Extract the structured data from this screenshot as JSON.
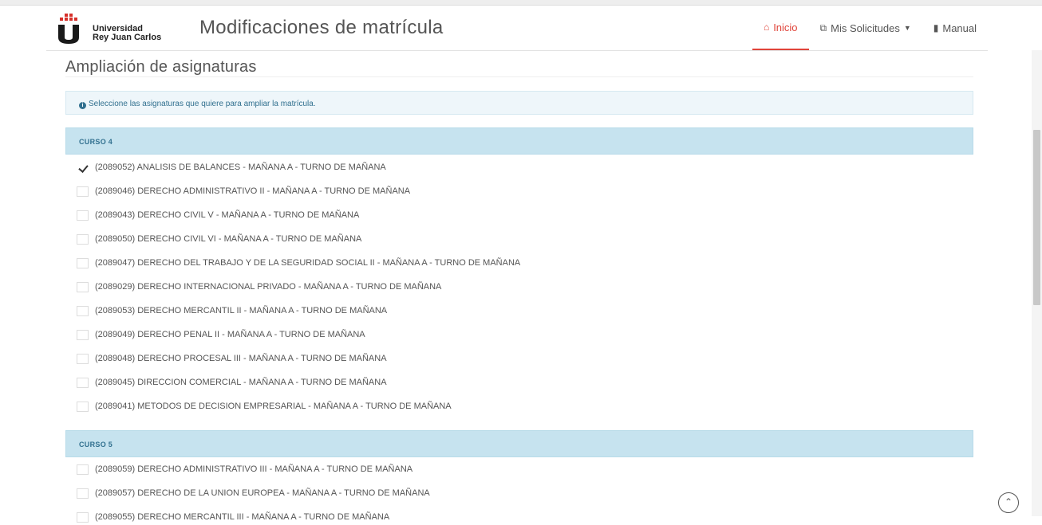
{
  "header": {
    "university_line1": "Universidad",
    "university_line2": "Rey Juan Carlos",
    "app_title": "Modificaciones de matrícula",
    "nav": [
      {
        "label": "Inicio",
        "icon": "home-icon",
        "active": true
      },
      {
        "label": "Mis Solicitudes",
        "icon": "copy-icon",
        "dropdown": true
      },
      {
        "label": "Manual",
        "icon": "book-icon"
      }
    ]
  },
  "main": {
    "heading": "Ampliación de asignaturas",
    "alert": "Seleccione las asignaturas que quiere para ampliar la matrícula.",
    "sections": [
      {
        "title": "CURSO 4",
        "subjects": [
          {
            "label": "(2089052) ANALISIS DE BALANCES - MAÑANA A - TURNO DE MAÑANA",
            "checked": true
          },
          {
            "label": "(2089046) DERECHO ADMINISTRATIVO II - MAÑANA A - TURNO DE MAÑANA",
            "checked": false
          },
          {
            "label": "(2089043) DERECHO CIVIL V - MAÑANA A - TURNO DE MAÑANA",
            "checked": false
          },
          {
            "label": "(2089050) DERECHO CIVIL VI - MAÑANA A - TURNO DE MAÑANA",
            "checked": false
          },
          {
            "label": "(2089047) DERECHO DEL TRABAJO Y DE LA SEGURIDAD SOCIAL II - MAÑANA A - TURNO DE MAÑANA",
            "checked": false
          },
          {
            "label": "(2089029) DERECHO INTERNACIONAL PRIVADO - MAÑANA A - TURNO DE MAÑANA",
            "checked": false
          },
          {
            "label": "(2089053) DERECHO MERCANTIL II - MAÑANA A - TURNO DE MAÑANA",
            "checked": false
          },
          {
            "label": "(2089049) DERECHO PENAL II - MAÑANA A - TURNO DE MAÑANA",
            "checked": false
          },
          {
            "label": "(2089048) DERECHO PROCESAL III - MAÑANA A - TURNO DE MAÑANA",
            "checked": false
          },
          {
            "label": "(2089045) DIRECCION COMERCIAL - MAÑANA A - TURNO DE MAÑANA",
            "checked": false
          },
          {
            "label": "(2089041) METODOS DE DECISION EMPRESARIAL - MAÑANA A - TURNO DE MAÑANA",
            "checked": false
          }
        ]
      },
      {
        "title": "CURSO 5",
        "subjects": [
          {
            "label": "(2089059) DERECHO ADMINISTRATIVO III - MAÑANA A - TURNO DE MAÑANA",
            "checked": false
          },
          {
            "label": "(2089057) DERECHO DE LA UNION EUROPEA - MAÑANA A - TURNO DE MAÑANA",
            "checked": false
          },
          {
            "label": "(2089055) DERECHO MERCANTIL III - MAÑANA A - TURNO DE MAÑANA",
            "checked": false
          }
        ]
      }
    ]
  },
  "colors": {
    "accent": "#e0443a",
    "section_bg": "#c6e3ef",
    "alert_bg": "#eef6fa",
    "info_text": "#31708f"
  }
}
